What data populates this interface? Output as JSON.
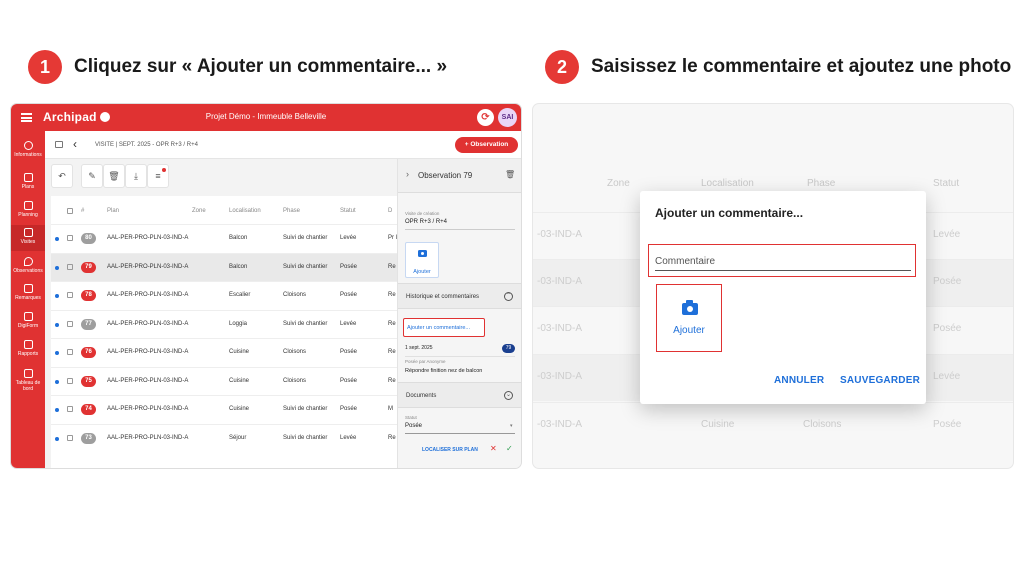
{
  "steps": [
    {
      "number": "1",
      "text": "Cliquez sur « Ajouter un commentaire... »"
    },
    {
      "number": "2",
      "text": "Saisissez le commentaire et ajoutez une photo"
    }
  ],
  "app": {
    "logo": "Archipad",
    "project_title": "Projet Démo - Immeuble Belleville",
    "sync_icon": "sync-icon",
    "avatar": "SAI",
    "brand_color": "#e03232",
    "sidebar": [
      {
        "label": "Informations",
        "icon": "info-icon"
      },
      {
        "label": "Plans",
        "icon": "map-icon"
      },
      {
        "label": "Planning",
        "icon": "calendar-icon"
      },
      {
        "label": "Visites",
        "icon": "visit-icon"
      },
      {
        "label": "Observations",
        "icon": "pin-icon"
      },
      {
        "label": "Remarques",
        "icon": "note-icon"
      },
      {
        "label": "DigiForm",
        "icon": "form-icon"
      },
      {
        "label": "Rapports",
        "icon": "report-icon"
      },
      {
        "label": "Tableau de bord",
        "icon": "dashboard-icon"
      }
    ],
    "breadcrumb": "VISITE  |  SEPT. 2025 - OPR R+3 / R+4",
    "observation_button": "+ Observation",
    "table": {
      "headers": [
        "#",
        "Plan",
        "Zone",
        "Localisation",
        "Phase",
        "Statut",
        "D"
      ],
      "rows": [
        {
          "num": "80",
          "color": "grey",
          "plan": "AAL-PER-PRO-PLN-03-IND-A",
          "loc": "Balcon",
          "phase": "Suivi de chantier",
          "status": "Levée",
          "extra": "Pr la"
        },
        {
          "num": "79",
          "color": "red",
          "plan": "AAL-PER-PRO-PLN-03-IND-A",
          "loc": "Balcon",
          "phase": "Suivi de chantier",
          "status": "Posée",
          "extra": "Re"
        },
        {
          "num": "78",
          "color": "red",
          "plan": "AAL-PER-PRO-PLN-03-IND-A",
          "loc": "Escalier",
          "phase": "Cloisons",
          "status": "Posée",
          "extra": "Re"
        },
        {
          "num": "77",
          "color": "grey",
          "plan": "AAL-PER-PRO-PLN-03-IND-A",
          "loc": "Loggia",
          "phase": "Suivi de chantier",
          "status": "Levée",
          "extra": "Re"
        },
        {
          "num": "76",
          "color": "red",
          "plan": "AAL-PER-PRO-PLN-03-IND-A",
          "loc": "Cuisine",
          "phase": "Cloisons",
          "status": "Posée",
          "extra": "Re"
        },
        {
          "num": "75",
          "color": "red",
          "plan": "AAL-PER-PRO-PLN-03-IND-A",
          "loc": "Cuisine",
          "phase": "Cloisons",
          "status": "Posée",
          "extra": "Re"
        },
        {
          "num": "74",
          "color": "red",
          "plan": "AAL-PER-PRO-PLN-03-IND-A",
          "loc": "Cuisine",
          "phase": "Suivi de chantier",
          "status": "Posée",
          "extra": "M"
        },
        {
          "num": "73",
          "color": "grey",
          "plan": "AAL-PER-PRO-PLN-03-IND-A",
          "loc": "Séjour",
          "phase": "Suivi de chantier",
          "status": "Levée",
          "extra": "Re"
        }
      ]
    },
    "detail": {
      "title": "Observation 79",
      "visit_label": "Visite de création",
      "visit_value": "OPR R+3 / R+4",
      "photo_label": "Ajouter",
      "history_title": "Historique et commentaires",
      "add_comment": "Ajouter un commentaire...",
      "date": "1 sept. 2025",
      "badge": "79",
      "posted_by": "Posée par Anonyme",
      "comment": "Répondre finition nez de balcon",
      "documents_title": "Documents",
      "status_label": "Statut",
      "status_value": "Posée",
      "locate": "LOCALISER SUR PLAN"
    }
  },
  "dialog": {
    "background_headers": [
      "Zone",
      "Localisation",
      "Phase",
      "Statut"
    ],
    "background_rows": [
      {
        "plan": "-03-IND-A",
        "status": "Levée"
      },
      {
        "plan": "-03-IND-A",
        "status": "Posée"
      },
      {
        "plan": "-03-IND-A",
        "status": "Posée"
      },
      {
        "plan": "-03-IND-A",
        "status": "Levée"
      },
      {
        "plan": "-03-IND-A",
        "loc": "Cuisine",
        "phase": "Cloisons",
        "status": "Posée"
      }
    ],
    "title": "Ajouter un commentaire...",
    "placeholder": "Commentaire",
    "photo_label": "Ajouter",
    "cancel": "ANNULER",
    "save": "SAUVEGARDER"
  }
}
